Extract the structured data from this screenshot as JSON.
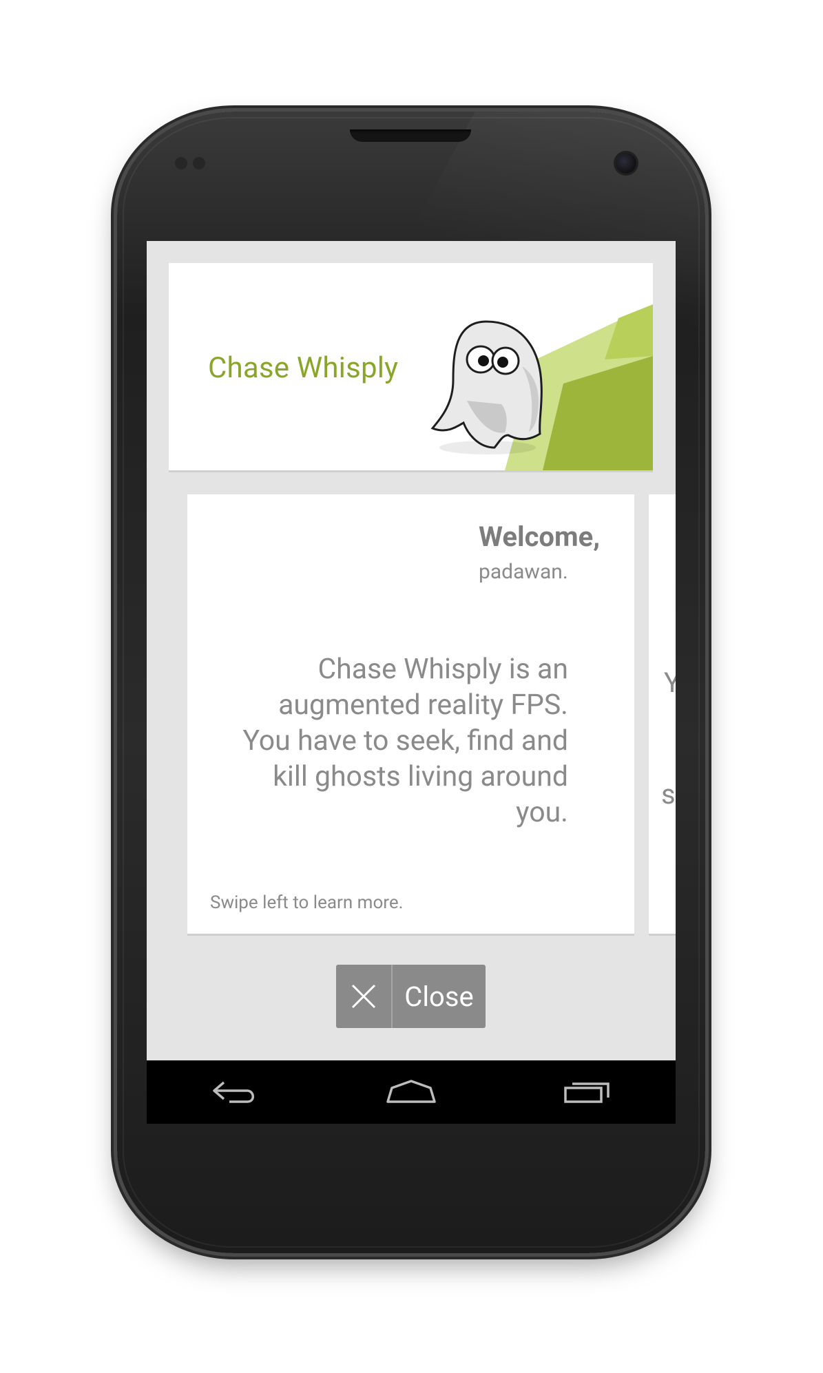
{
  "app": {
    "title": "Chase Whisply"
  },
  "welcome_card": {
    "heading": "Welcome,",
    "subheading": "padawan.",
    "body_lines": [
      "Chase Whisply is an",
      "augmented reality FPS.",
      "You have to seek, find and",
      "kill ghosts living around",
      "you."
    ],
    "hint": "Swipe left to learn more."
  },
  "next_card": {
    "fragments": [
      "Y",
      "s"
    ]
  },
  "actions": {
    "close_label": "Close",
    "close_icon": "close-icon"
  },
  "navigation": {
    "items": [
      {
        "icon": "back-icon"
      },
      {
        "icon": "home-icon"
      },
      {
        "icon": "recent-apps-icon"
      }
    ]
  },
  "colors": {
    "accent": "#8aa62a",
    "card_background": "#ffffff",
    "screen_background": "#e4e4e4",
    "text_gray": "#8a8a8a",
    "button_gray": "#8a8a8a",
    "navbar": "#000000"
  }
}
